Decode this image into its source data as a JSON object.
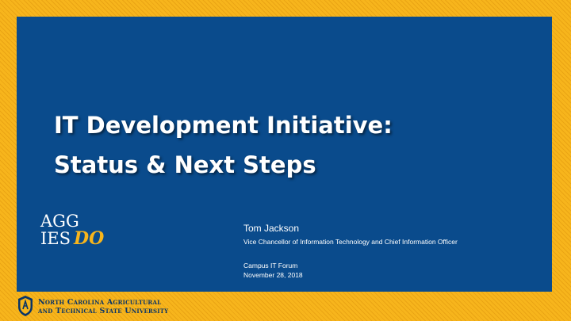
{
  "slide": {
    "title_line1": "IT Development Initiative:",
    "title_line2": "Status & Next Steps",
    "logo": {
      "line1": "AGG",
      "line2": "IES",
      "accent": "DO"
    },
    "presenter_name": "Tom Jackson",
    "presenter_role": "Vice Chancellor of Information Technology and Chief Information Officer",
    "event_name": "Campus IT Forum",
    "event_date": "November 28, 2018"
  },
  "footer": {
    "university_line1": "North Carolina Agricultural",
    "university_line2": "and Technical State University",
    "seal_icon": "university-seal-icon"
  },
  "colors": {
    "background_gold": "#f7b51c",
    "panel_blue": "#0a4b8c",
    "text_white": "#ffffff",
    "footer_text": "#0a3567"
  }
}
